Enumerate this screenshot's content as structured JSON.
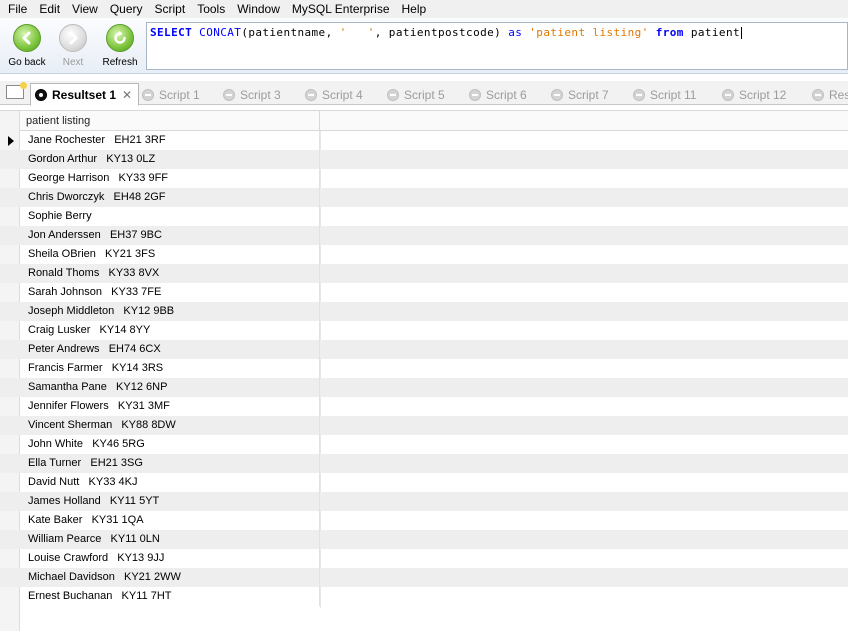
{
  "menu": [
    "File",
    "Edit",
    "View",
    "Query",
    "Script",
    "Tools",
    "Window",
    "MySQL Enterprise",
    "Help"
  ],
  "toolbar": {
    "go_back": "Go back",
    "next": "Next",
    "refresh": "Refresh"
  },
  "query": {
    "select": "SELECT",
    "concat": "CONCAT",
    "args1": "(patientname, ",
    "sep": "'   '",
    "args2": ", patientpostcode) ",
    "as": "as",
    "alias": "'patient listing'",
    "from": "from",
    "table": "patient"
  },
  "tabs": {
    "active": "Resultset 1",
    "scripts": [
      "Script 1",
      "Script 3",
      "Script 4",
      "Script 5",
      "Script 6",
      "Script 7",
      "Script 11",
      "Script 12",
      "Res"
    ]
  },
  "grid": {
    "column": "patient listing",
    "rows": [
      "Jane Rochester   EH21 3RF",
      "Gordon Arthur   KY13 0LZ",
      "George Harrison   KY33 9FF",
      "Chris Dworczyk   EH48 2GF",
      "Sophie Berry",
      "Jon Anderssen   EH37 9BC",
      "Sheila OBrien   KY21 3FS",
      "Ronald Thoms   KY33 8VX",
      "Sarah Johnson   KY33 7FE",
      "Joseph Middleton   KY12 9BB",
      "Craig Lusker   KY14 8YY",
      "Peter Andrews   EH74 6CX",
      "Francis Farmer   KY14 3RS",
      "Samantha Pane   KY12 6NP",
      "Jennifer Flowers   KY31 3MF",
      "Vincent Sherman   KY88 8DW",
      "John White   KY46 5RG",
      "Ella Turner   EH21 3SG",
      "David Nutt   KY33 4KJ",
      "James Holland   KY11 5YT",
      "Kate Baker   KY31 1QA",
      "William Pearce   KY11 0LN",
      "Louise Crawford   KY13 9JJ",
      "Michael Davidson   KY21 2WW",
      "Ernest Buchanan   KY11 7HT"
    ]
  }
}
